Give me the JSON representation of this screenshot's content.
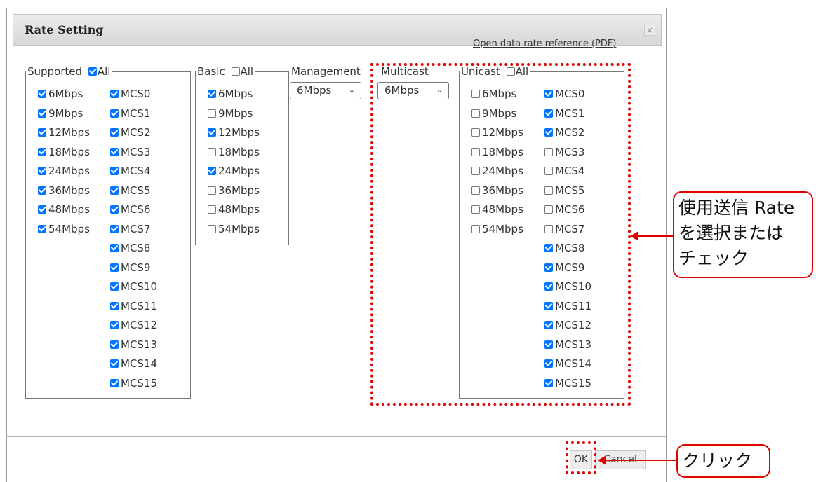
{
  "dialog": {
    "title": "Rate Setting",
    "close_label": "×",
    "ref_link": "Open data rate reference (PDF)"
  },
  "supported": {
    "legend": "Supported",
    "all_label": "All",
    "all_checked": true,
    "rates": [
      {
        "label": "6Mbps",
        "checked": true
      },
      {
        "label": "9Mbps",
        "checked": true
      },
      {
        "label": "12Mbps",
        "checked": true
      },
      {
        "label": "18Mbps",
        "checked": true
      },
      {
        "label": "24Mbps",
        "checked": true
      },
      {
        "label": "36Mbps",
        "checked": true
      },
      {
        "label": "48Mbps",
        "checked": true
      },
      {
        "label": "54Mbps",
        "checked": true
      }
    ],
    "mcs": [
      {
        "label": "MCS0",
        "checked": true
      },
      {
        "label": "MCS1",
        "checked": true
      },
      {
        "label": "MCS2",
        "checked": true
      },
      {
        "label": "MCS3",
        "checked": true
      },
      {
        "label": "MCS4",
        "checked": true
      },
      {
        "label": "MCS5",
        "checked": true
      },
      {
        "label": "MCS6",
        "checked": true
      },
      {
        "label": "MCS7",
        "checked": true
      },
      {
        "label": "MCS8",
        "checked": true
      },
      {
        "label": "MCS9",
        "checked": true
      },
      {
        "label": "MCS10",
        "checked": true
      },
      {
        "label": "MCS11",
        "checked": true
      },
      {
        "label": "MCS12",
        "checked": true
      },
      {
        "label": "MCS13",
        "checked": true
      },
      {
        "label": "MCS14",
        "checked": true
      },
      {
        "label": "MCS15",
        "checked": true
      }
    ]
  },
  "basic": {
    "legend": "Basic",
    "all_label": "All",
    "all_checked": false,
    "rates": [
      {
        "label": "6Mbps",
        "checked": true
      },
      {
        "label": "9Mbps",
        "checked": false
      },
      {
        "label": "12Mbps",
        "checked": true
      },
      {
        "label": "18Mbps",
        "checked": false
      },
      {
        "label": "24Mbps",
        "checked": true
      },
      {
        "label": "36Mbps",
        "checked": false
      },
      {
        "label": "48Mbps",
        "checked": false
      },
      {
        "label": "54Mbps",
        "checked": false
      }
    ]
  },
  "management": {
    "label": "Management",
    "value": "6Mbps",
    "arrow": "⌄"
  },
  "multicast": {
    "label": "Multicast",
    "value": "6Mbps",
    "arrow": "⌄"
  },
  "unicast": {
    "legend": "Unicast",
    "all_label": "All",
    "all_checked": false,
    "rates": [
      {
        "label": "6Mbps",
        "checked": false
      },
      {
        "label": "9Mbps",
        "checked": false
      },
      {
        "label": "12Mbps",
        "checked": false
      },
      {
        "label": "18Mbps",
        "checked": false
      },
      {
        "label": "24Mbps",
        "checked": false
      },
      {
        "label": "36Mbps",
        "checked": false
      },
      {
        "label": "48Mbps",
        "checked": false
      },
      {
        "label": "54Mbps",
        "checked": false
      }
    ],
    "mcs": [
      {
        "label": "MCS0",
        "checked": true
      },
      {
        "label": "MCS1",
        "checked": true
      },
      {
        "label": "MCS2",
        "checked": true
      },
      {
        "label": "MCS3",
        "checked": false
      },
      {
        "label": "MCS4",
        "checked": false
      },
      {
        "label": "MCS5",
        "checked": false
      },
      {
        "label": "MCS6",
        "checked": false
      },
      {
        "label": "MCS7",
        "checked": false
      },
      {
        "label": "MCS8",
        "checked": true
      },
      {
        "label": "MCS9",
        "checked": true
      },
      {
        "label": "MCS10",
        "checked": true
      },
      {
        "label": "MCS11",
        "checked": true
      },
      {
        "label": "MCS12",
        "checked": true
      },
      {
        "label": "MCS13",
        "checked": true
      },
      {
        "label": "MCS14",
        "checked": true
      },
      {
        "label": "MCS15",
        "checked": true
      }
    ]
  },
  "buttons": {
    "ok": "OK",
    "cancel": "Cancel"
  },
  "annotations": {
    "rate_note_line1": "使用送信 Rate",
    "rate_note_line2": "を選択または",
    "rate_note_line3": "チェック",
    "click_note": "クリック",
    "highlight_color": "#e00000"
  }
}
